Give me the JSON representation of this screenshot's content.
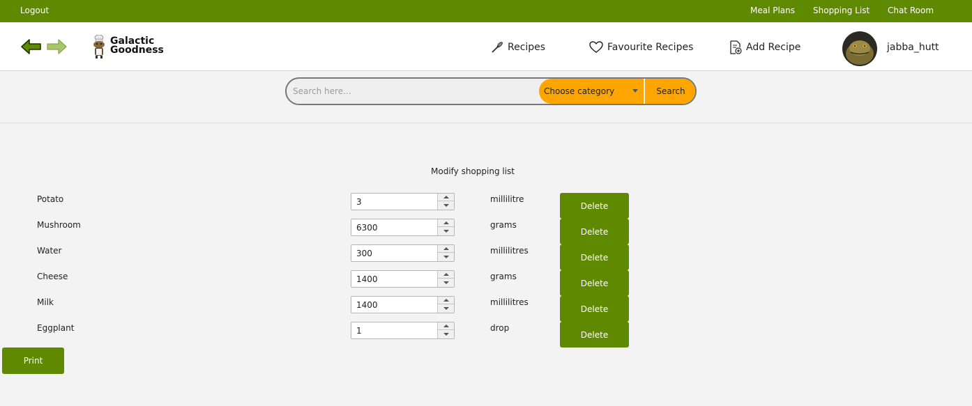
{
  "topbar": {
    "logout": "Logout",
    "meal_plans": "Meal Plans",
    "shopping_list": "Shopping List",
    "chat_room": "Chat Room",
    "color": "#5f8a00"
  },
  "header": {
    "logo_line1": "Galactic",
    "logo_line2": "Goodness",
    "nav": {
      "recipes": "Recipes",
      "favourite_recipes": "Favourite Recipes",
      "add_recipe": "Add Recipe"
    },
    "username": "jabba_hutt"
  },
  "search": {
    "placeholder": "Search here...",
    "category": "Choose category",
    "button": "Search",
    "accent": "#ffa500"
  },
  "main": {
    "title": "Modify shopping list",
    "items": [
      {
        "name": "Potato",
        "quantity": "3",
        "unit": "millilitre",
        "delete": "Delete"
      },
      {
        "name": "Mushroom",
        "quantity": "6300",
        "unit": "grams",
        "delete": "Delete"
      },
      {
        "name": "Water",
        "quantity": "300",
        "unit": "millilitres",
        "delete": "Delete"
      },
      {
        "name": "Cheese",
        "quantity": "1400",
        "unit": "grams",
        "delete": "Delete"
      },
      {
        "name": "Milk",
        "quantity": "1400",
        "unit": "millilitres",
        "delete": "Delete"
      },
      {
        "name": "Eggplant",
        "quantity": "1",
        "unit": "drop",
        "delete": "Delete"
      }
    ],
    "print": "Print"
  }
}
